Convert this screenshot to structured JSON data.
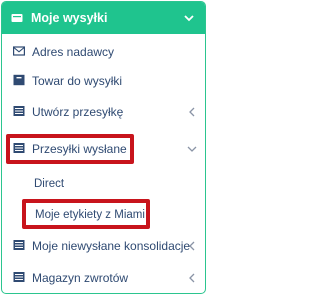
{
  "menu": {
    "header": "Moje wysyłki",
    "items": [
      {
        "label": "Adres nadawcy",
        "icon": "envelope-icon"
      },
      {
        "label": "Towar do wysyłki",
        "icon": "box-icon"
      },
      {
        "label": "Utwórz przesyłkę",
        "icon": "list-icon"
      },
      {
        "label": "Przesyłki wysłane",
        "icon": "list-icon"
      },
      {
        "label": "Moje niewysłane konsolidacje",
        "icon": "list-icon"
      },
      {
        "label": "Magazyn zwrotów",
        "icon": "list-icon"
      }
    ],
    "submenu": [
      "Direct",
      "Moje etykiety z Miami"
    ]
  },
  "colors": {
    "accent": "#1fc48e",
    "text": "#2f4a72",
    "highlight": "#c8141c"
  }
}
